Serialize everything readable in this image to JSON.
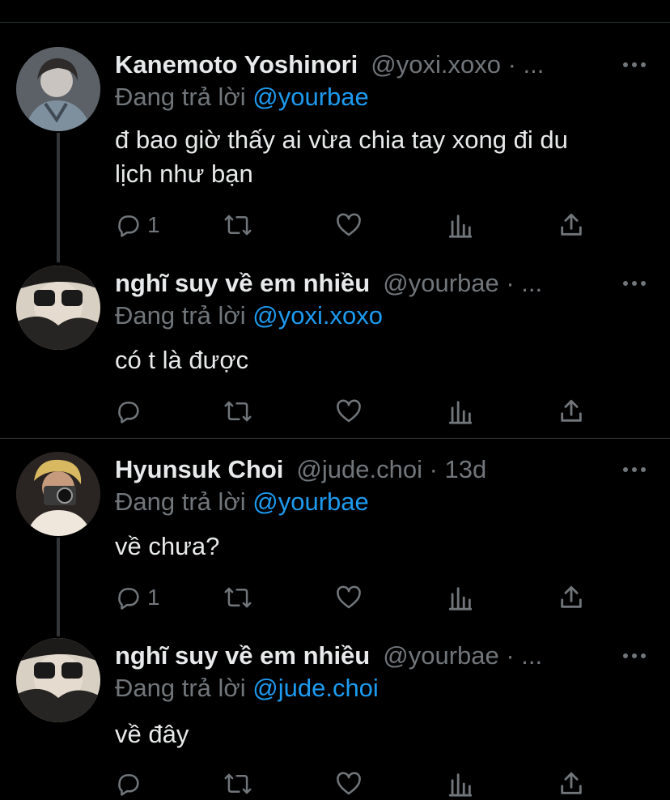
{
  "tweets": [
    {
      "name": "Kanemoto Yoshinori",
      "handle": "@yoxi.xoxo · ...",
      "reply_prefix": "Đang trả lời",
      "reply_to": "@yourbae",
      "text_lines": [
        "đ bao giờ thấy ai vừa chia tay xong đi du",
        "lịch như bạn"
      ],
      "reply_count": "1"
    },
    {
      "name": "nghĩ suy về em nhiều",
      "handle": "@yourbae · ...",
      "reply_prefix": "Đang trả lời",
      "reply_to": "@yoxi.xoxo",
      "text_lines": [
        "có t là được"
      ],
      "reply_count": ""
    },
    {
      "name": "Hyunsuk Choi",
      "handle": "@jude.choi · 13d",
      "reply_prefix": "Đang trả lời",
      "reply_to": "@yourbae",
      "text_lines": [
        "về chưa?"
      ],
      "reply_count": "1"
    },
    {
      "name": "nghĩ suy về em nhiều",
      "handle": "@yourbae · ...",
      "reply_prefix": "Đang trả lời",
      "reply_to": "@jude.choi",
      "text_lines": [
        "về đây"
      ],
      "reply_count": ""
    }
  ],
  "icons": {
    "reply": "reply-icon",
    "retweet": "retweet-icon",
    "like": "heart-icon",
    "views": "analytics-icon",
    "share": "share-icon",
    "more": "more-icon"
  },
  "colors": {
    "background": "#000000",
    "text": "#e7e9ea",
    "muted": "#71767b",
    "mention": "#1d9bf0",
    "divider": "#2f3336"
  }
}
